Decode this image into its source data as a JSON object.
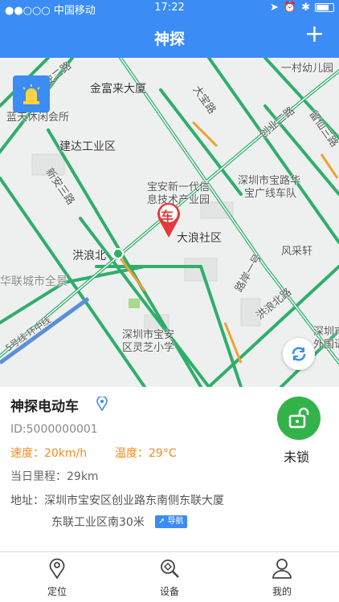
{
  "status_bar": {
    "carrier": "●●○○○ 中国移动",
    "time": "17:22"
  },
  "nav": {
    "title": "神探",
    "add_label": "+"
  },
  "map": {
    "labels": [
      {
        "id": "a",
        "text": "一村幼儿园"
      },
      {
        "id": "b",
        "text": "金富来大厦"
      },
      {
        "id": "c",
        "text": "蓝天休闲会所"
      },
      {
        "id": "d",
        "text": "建达工业区"
      },
      {
        "id": "e",
        "text": "宝安新一代信"
      },
      {
        "id": "f",
        "text": "息技术产业园"
      },
      {
        "id": "g",
        "text": "深圳市宝路华"
      },
      {
        "id": "h",
        "text": "宝广线车队"
      },
      {
        "id": "i",
        "text": "大浪社区"
      },
      {
        "id": "j",
        "text": "洪浪北"
      },
      {
        "id": "k",
        "text": "风采轩"
      },
      {
        "id": "l",
        "text": "华联城市全景"
      },
      {
        "id": "m",
        "text": "深圳市宝安"
      },
      {
        "id": "n",
        "text": "区灵芝小学"
      },
      {
        "id": "o",
        "text": "深圳市"
      },
      {
        "id": "p",
        "text": "外国语"
      },
      {
        "id": "q",
        "text": "创业二路"
      },
      {
        "id": "r",
        "text": "新安三路"
      },
      {
        "id": "s",
        "text": "洪浪北路"
      },
      {
        "id": "t",
        "text": "留仙三路"
      },
      {
        "id": "u",
        "text": "5号线·环中线"
      },
      {
        "id": "v",
        "text": "大宝路"
      },
      {
        "id": "w",
        "text": "新安二路"
      },
      {
        "id": "x",
        "text": "路岸一号"
      }
    ],
    "marker_label": "车"
  },
  "device": {
    "name": "神探电动车",
    "id": "ID:5000000001",
    "speed": "速度：20km/h",
    "temperature": "温度：29°C",
    "mileage": "当日里程：29km",
    "address_line1": "地址：深圳市宝安区创业路东南侧东联大厦",
    "address_line2": "东联工业区南30米",
    "nav_badge": "导航",
    "lock_status": "未锁"
  },
  "tabs": [
    {
      "label": "定位"
    },
    {
      "label": "设备"
    },
    {
      "label": "我的"
    }
  ],
  "colors": {
    "primary": "#3b8cf5",
    "road_green": "#2fae6a",
    "lock_green": "#34b24a",
    "accent_orange": "#f08b1e"
  }
}
